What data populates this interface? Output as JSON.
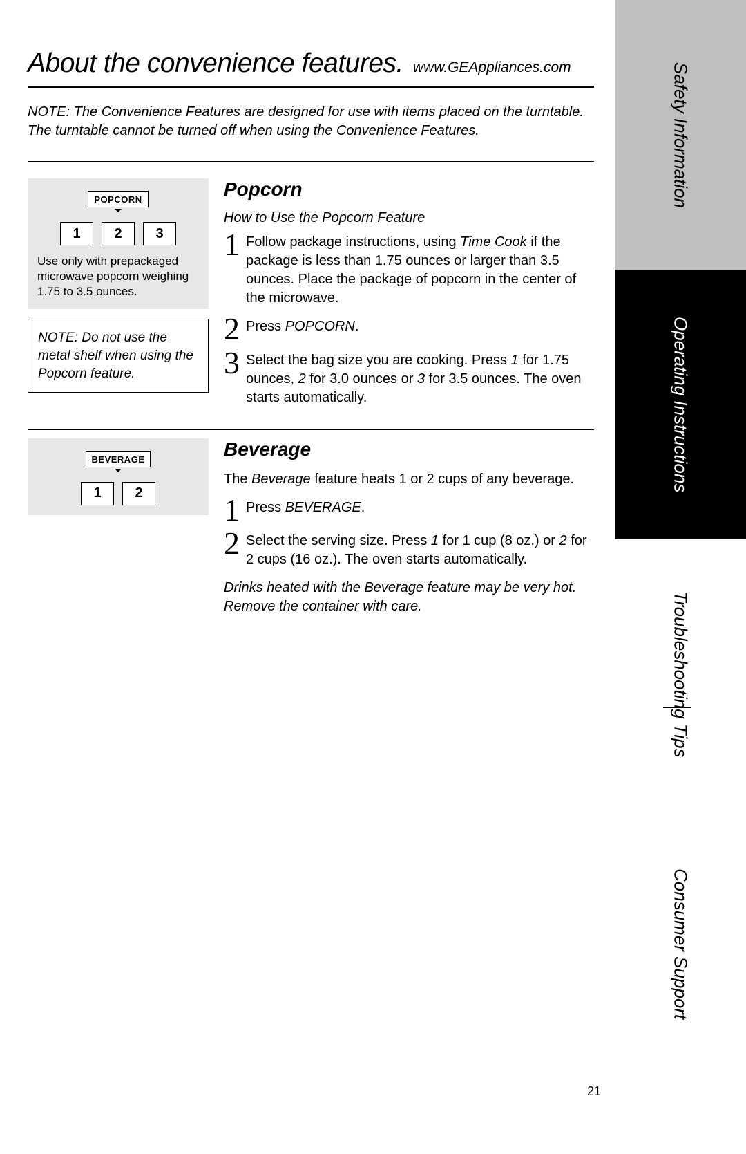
{
  "header": {
    "title": "About the convenience features.",
    "url": "www.GEAppliances.com"
  },
  "topnote": "NOTE: The Convenience Features are designed for use with items placed on the turntable. The turntable cannot be turned off when using the Convenience Features.",
  "popcorn": {
    "title": "Popcorn",
    "subtitle": "How to Use the Popcorn Feature",
    "panel_button": "POPCORN",
    "panel_nums": [
      "1",
      "2",
      "3"
    ],
    "panel_caption": "Use only with prepackaged microwave popcorn weighing 1.75 to 3.5 ounces.",
    "notebox": "NOTE: Do not use the metal shelf when using the Popcorn feature.",
    "steps": [
      {
        "n": "1",
        "pre": "Follow package instructions, using ",
        "kw": "Time Cook",
        "post": " if the package is less than 1.75 ounces or larger than 3.5 ounces. Place the package of popcorn in the center of the microwave."
      },
      {
        "n": "2",
        "pre": "Press ",
        "kw": "POPCORN",
        "post": "."
      },
      {
        "n": "3",
        "pre": "Select the bag size you are cooking. Press ",
        "kw": "1",
        "mid1": " for 1.75 ounces, ",
        "kw2": "2",
        "mid2": " for 3.0 ounces or ",
        "kw3": "3",
        "post": " for 3.5 ounces. The oven starts automatically."
      }
    ]
  },
  "beverage": {
    "title": "Beverage",
    "panel_button": "BEVERAGE",
    "panel_nums": [
      "1",
      "2"
    ],
    "intro_pre": "The ",
    "intro_kw": "Beverage",
    "intro_post": " feature heats 1 or 2 cups of any beverage.",
    "steps": [
      {
        "n": "1",
        "pre": "Press ",
        "kw": "BEVERAGE",
        "post": "."
      },
      {
        "n": "2",
        "pre": "Select the serving size. Press ",
        "kw": "1",
        "mid1": " for 1 cup (8 oz.) or ",
        "kw2": "2",
        "post": " for 2 cups (16 oz.). The oven starts automatically."
      }
    ],
    "caution": "Drinks heated with the Beverage feature may be very hot. Remove the container with care."
  },
  "sidebar": {
    "tabs": [
      "Safety Information",
      "Operating Instructions",
      "Troubleshooting Tips",
      "Consumer Support"
    ]
  },
  "page_number": "21"
}
